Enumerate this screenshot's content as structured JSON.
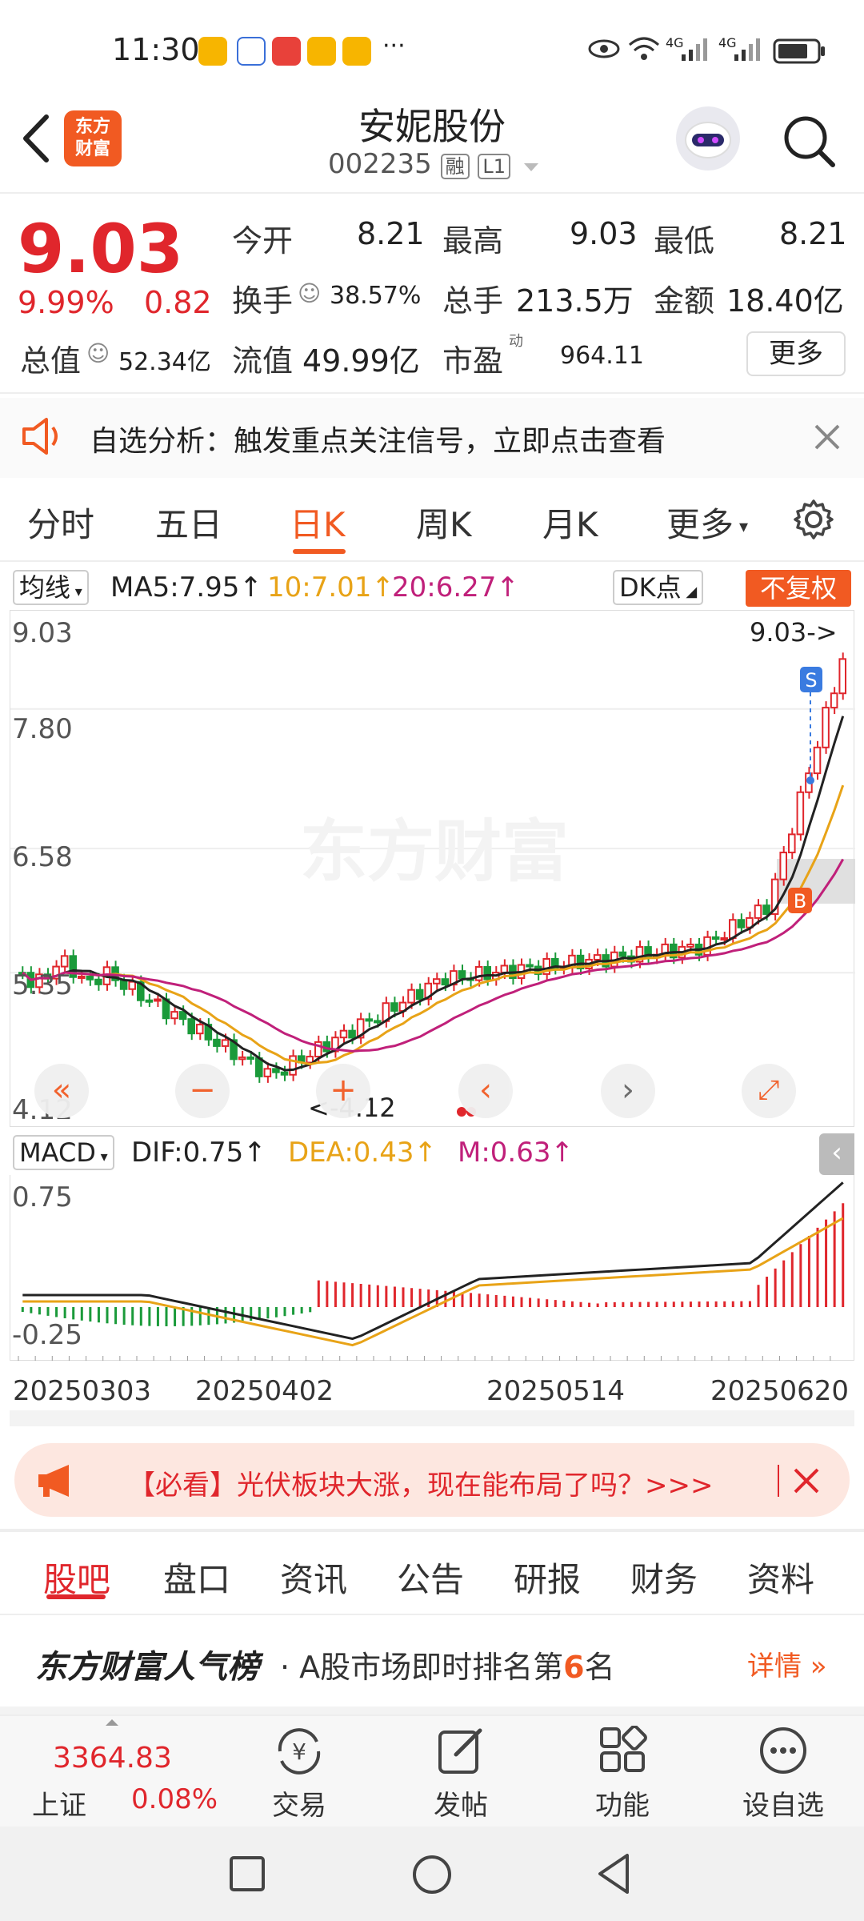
{
  "status_bar": {
    "time": "11:30",
    "more": "···",
    "net1": "4G",
    "net2": "4G"
  },
  "header": {
    "logo_line1": "东方",
    "logo_line2": "财富",
    "name": "安妮股份",
    "code": "002235",
    "tag1": "融",
    "tag2": "L1"
  },
  "quote": {
    "price": "9.03",
    "change_pct": "9.99%",
    "change": "0.82",
    "open_label": "今开",
    "open": "8.21",
    "high_label": "最高",
    "high": "9.03",
    "low_label": "最低",
    "low": "8.21",
    "turnover_label": "换手",
    "turnover": "38.57%",
    "volume_label": "总手",
    "volume": "213.5万",
    "amount_label": "金额",
    "amount": "18.40亿",
    "mktcap_label": "总值",
    "mktcap": "52.34亿",
    "float_label": "流值",
    "float": "49.99亿",
    "pe_label": "市盈",
    "pe_sup": "动",
    "pe": "964.11",
    "more": "更多"
  },
  "alert": {
    "text": "自选分析：触发重点关注信号，立即点击查看"
  },
  "chart_tabs": [
    "分时",
    "五日",
    "日K",
    "周K",
    "月K",
    "更多"
  ],
  "kline": {
    "indicator": "均线",
    "ma5": "MA5:7.95↑",
    "ma10": "10:7.01↑",
    "ma20": "20:6.27↑",
    "dk": "DK点",
    "restore": "不复权",
    "y_ticks": [
      "9.03",
      "7.80",
      "6.58",
      "5.35",
      "4.12"
    ],
    "max_label": "9.03->",
    "min_label": "<-4.12",
    "watermark": "东方财富",
    "sell_mark": "S",
    "buy_mark": "B",
    "colors": {
      "up": "#e0262c",
      "down": "#1a9a3a",
      "ma5": "#222222",
      "ma10": "#e8a317",
      "ma20": "#c0207a"
    }
  },
  "macd": {
    "indicator": "MACD",
    "dif": "DIF:0.75↑",
    "dea": "DEA:0.43↑",
    "m": "M:0.63↑",
    "y_ticks": [
      "0.75",
      "-0.25"
    ],
    "x_labels": [
      "20250303",
      "20250402",
      "20250514",
      "20250620"
    ]
  },
  "ad": {
    "text": "【必看】光伏板块大涨，现在能布局了吗？>>>"
  },
  "section_tabs": [
    "股吧",
    "盘口",
    "资讯",
    "公告",
    "研报",
    "财务",
    "资料"
  ],
  "rank": {
    "brand": "东方财富人气榜",
    "text_prefix": "· A股市场即时排名第",
    "rank_no": "6",
    "text_suffix": "名",
    "detail": "详情"
  },
  "bottom_bar": {
    "index_value": "3364.83",
    "index_name": "上证",
    "index_pct": "0.08%",
    "trade": "交易",
    "post": "发帖",
    "func": "功能",
    "watchlist": "设自选"
  }
}
